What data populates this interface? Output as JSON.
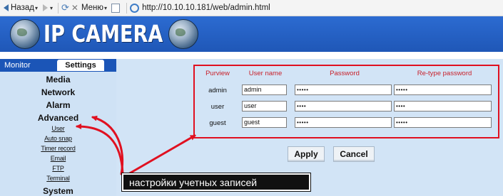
{
  "browser": {
    "back_label": "Назад",
    "menu_label": "Меню",
    "address": "http://10.10.10.181/web/admin.html"
  },
  "header": {
    "brand": "IP CAMERA"
  },
  "sidebar": {
    "tabs": [
      "Monitor",
      "Settings"
    ],
    "menu": [
      "Media",
      "Network",
      "Alarm",
      "Advanced"
    ],
    "advanced_sub": [
      "User",
      "Auto snap",
      "Timer record",
      "Email",
      "FTP",
      "Terminal"
    ],
    "system_label": "System"
  },
  "users_table": {
    "headers": [
      "Purview",
      "User name",
      "Password",
      "Re-type password"
    ],
    "rows": [
      {
        "purview": "admin",
        "username": "admin",
        "password": "•••••",
        "retype": "•••••"
      },
      {
        "purview": "user",
        "username": "user",
        "password": "••••",
        "retype": "••••"
      },
      {
        "purview": "guest",
        "username": "guest",
        "password": "•••••",
        "retype": "•••••"
      }
    ]
  },
  "buttons": {
    "apply": "Apply",
    "cancel": "Cancel"
  },
  "annotation": {
    "text": "настройки учетных записей",
    "color": "#e01020"
  }
}
